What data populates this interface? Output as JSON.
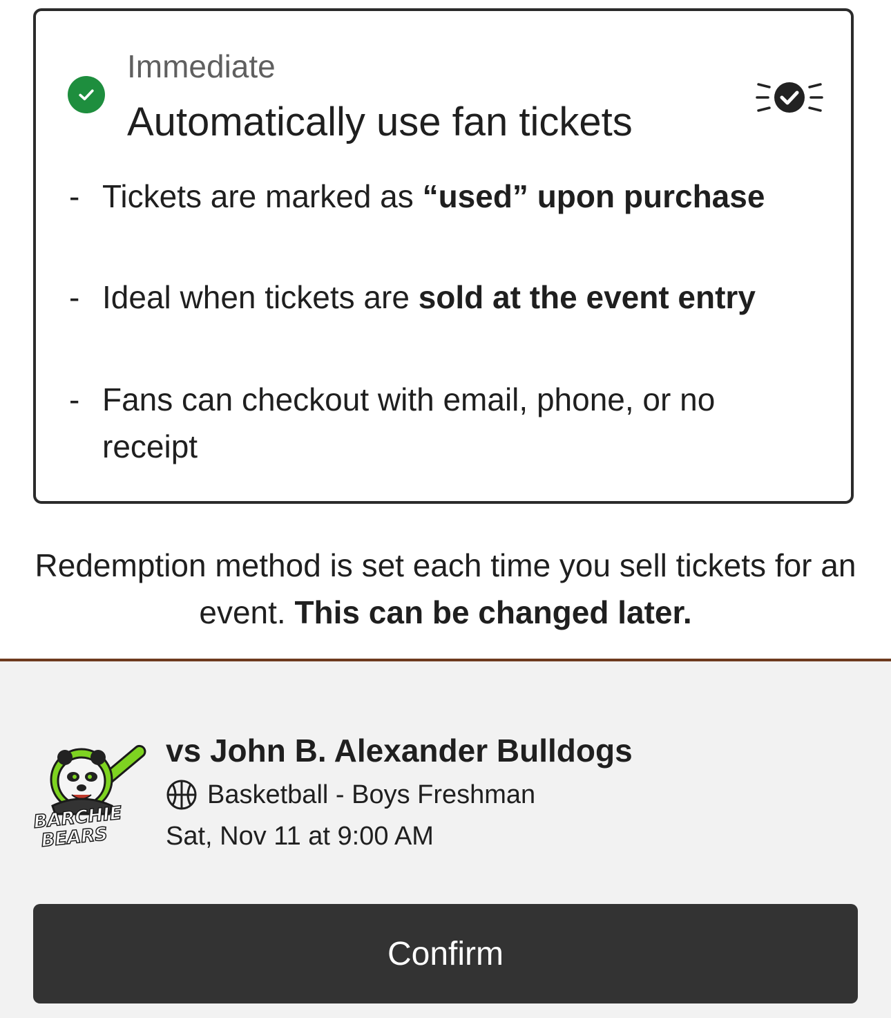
{
  "option": {
    "eyebrow": "Immediate",
    "title": "Automatically use fan tickets",
    "bullets": [
      {
        "dash": "-",
        "text": "Tickets are marked as ",
        "bold": "“used” upon purchase"
      },
      {
        "dash": "-",
        "text": "Ideal when tickets are ",
        "bold": "sold at the event entry"
      },
      {
        "dash": "-",
        "text": "Fans can checkout with email, phone, or no receipt",
        "bold": ""
      }
    ],
    "icons": {
      "selected": "check-circle-icon",
      "type": "ticket-check-burst-icon"
    }
  },
  "note": {
    "text": "Redemption method is set each time you sell tickets for an event. ",
    "bold": "This can be changed later."
  },
  "event": {
    "logo_text_1": "BARCHIE",
    "logo_text_2": "BEARS",
    "title": "vs John B. Alexander Bulldogs",
    "sport": "Basketball - Boys Freshman",
    "sport_icon": "basketball-icon",
    "date": "Sat, Nov 11 at 9:00 AM"
  },
  "actions": {
    "confirm_label": "Confirm"
  },
  "colors": {
    "success": "#1e8e3e",
    "divider": "#6e3b1e",
    "button": "#333333",
    "panel": "#f2f2f2",
    "logo_green": "#7ed321"
  }
}
